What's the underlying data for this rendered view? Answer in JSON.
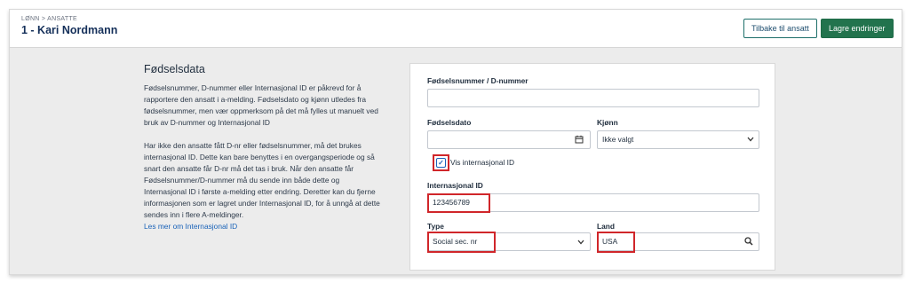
{
  "header": {
    "breadcrumb": "LØNN > ANSATTE",
    "title": "1 - Kari Nordmann",
    "back_button": "Tilbake til ansatt",
    "save_button": "Lagre endringer"
  },
  "info": {
    "title": "Fødselsdata",
    "paragraph1": "Fødselsnummer, D-nummer eller Internasjonal ID er påkrevd for å rapportere den ansatt i a-melding. Fødselsdato og kjønn utledes fra fødselsnummer, men vær oppmerksom på det må fylles ut manuelt ved bruk av D-nummer og Internasjonal ID",
    "paragraph2": "Har ikke den ansatte fått D-nr eller fødselsnummer, må det brukes internasjonal ID. Dette kan bare benyttes i en overgangsperiode og så snart den ansatte får D-nr må det tas i bruk. Når den ansatte får Fødselsnummer/D-nummer må du sende inn både dette og Internasjonal ID i første a-melding etter endring. Deretter kan du fjerne informasjonen som er lagret under Internasjonal ID, for å unngå at dette sendes inn i flere A-meldinger.",
    "link": "Les mer om Internasjonal ID"
  },
  "form": {
    "ssn_label": "Fødselsnummer / D-nummer",
    "ssn_value": "",
    "birthdate_label": "Fødselsdato",
    "birthdate_value": "",
    "gender_label": "Kjønn",
    "gender_value": "Ikke valgt",
    "show_intl_label": "Vis internasjonal ID",
    "show_intl_checked": true,
    "intl_id_label": "Internasjonal ID",
    "intl_id_value": "123456789",
    "type_label": "Type",
    "type_value": "Social sec. nr",
    "country_label": "Land",
    "country_value": "USA"
  },
  "icons": {
    "calendar": "calendar-icon",
    "chevron": "chevron-down-icon",
    "search": "search-icon",
    "check": "checkmark-icon"
  },
  "colors": {
    "primary": "#22734d",
    "link": "#1b63b8",
    "title": "#15305a",
    "highlight": "#d0262a"
  }
}
